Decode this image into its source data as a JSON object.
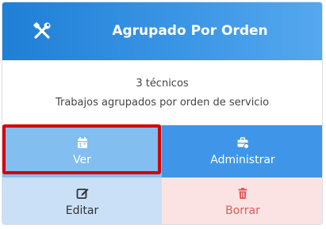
{
  "card": {
    "title": "Agrupado Por Orden",
    "header_icon": "tools-icon",
    "subtitle_count": "3 técnicos",
    "description": "Trabajos agrupados por orden de servicio"
  },
  "actions": {
    "ver": {
      "label": "Ver",
      "icon": "calendar-icon"
    },
    "administrar": {
      "label": "Administrar",
      "icon": "toolbox-icon"
    },
    "editar": {
      "label": "Editar",
      "icon": "edit-icon"
    },
    "borrar": {
      "label": "Borrar",
      "icon": "trash-icon"
    }
  },
  "colors": {
    "header": "#2a86dc",
    "ver": "#82bef0",
    "administrar": "#3f96e8",
    "editar": "#c9e0f7",
    "borrar": "#fbe3e3",
    "borrar_text": "#e05a5a",
    "highlight": "#d40000"
  }
}
